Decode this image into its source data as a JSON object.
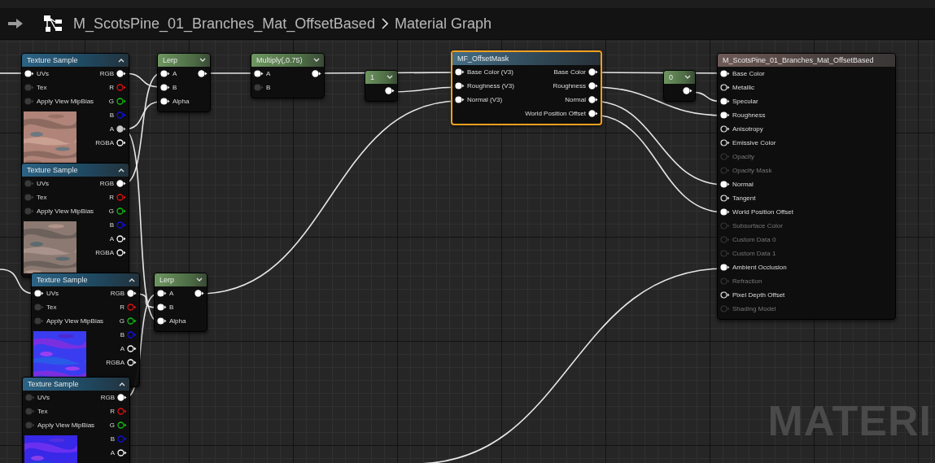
{
  "toolbar": {
    "title": "M_ScotsPine_01_Branches_Mat_OffsetBased",
    "breadcrumb": "Material Graph"
  },
  "nodes": [
    {
      "kind": "texture",
      "title": "Texture Sample",
      "selected": false,
      "inputs": [
        {
          "label": "UVs",
          "connected": true
        },
        {
          "label": "Tex",
          "connected": false
        },
        {
          "label": "Apply View MipBias",
          "connected": false
        }
      ],
      "outputs": [
        {
          "label": "RGB",
          "connected": true,
          "color": "#ffffff"
        },
        {
          "label": "R",
          "connected": false,
          "color": "#e01010"
        },
        {
          "label": "G",
          "connected": false,
          "color": "#10c010"
        },
        {
          "label": "B",
          "connected": false,
          "color": "#1010e0"
        },
        {
          "label": "A",
          "connected": true,
          "color": "#c8c8c8"
        },
        {
          "label": "RGBA",
          "connected": false,
          "color": "#ffffff"
        }
      ],
      "preview": {
        "kind": "picture"
      }
    },
    {
      "kind": "texture",
      "title": "Texture Sample",
      "selected": false,
      "inputs": [
        {
          "label": "UVs",
          "connected": false
        },
        {
          "label": "Tex",
          "connected": false
        },
        {
          "label": "Apply View MipBias",
          "connected": false
        }
      ],
      "outputs": [
        {
          "label": "RGB",
          "connected": true,
          "color": "#ffffff"
        },
        {
          "label": "R",
          "connected": false,
          "color": "#e01010"
        },
        {
          "label": "G",
          "connected": false,
          "color": "#10c010"
        },
        {
          "label": "B",
          "connected": false,
          "color": "#1010e0"
        },
        {
          "label": "A",
          "connected": false,
          "color": "#ffffff"
        },
        {
          "label": "RGBA",
          "connected": false,
          "color": "#ffffff"
        }
      ],
      "preview": {
        "kind": "picture"
      }
    },
    {
      "kind": "texture",
      "title": "Texture Sample",
      "selected": false,
      "inputs": [
        {
          "label": "UVs",
          "connected": true
        },
        {
          "label": "Tex",
          "connected": false
        },
        {
          "label": "Apply View MipBias",
          "connected": false
        }
      ],
      "outputs": [
        {
          "label": "RGB",
          "connected": true,
          "color": "#ffffff"
        },
        {
          "label": "R",
          "connected": false,
          "color": "#e01010"
        },
        {
          "label": "G",
          "connected": false,
          "color": "#10c010"
        },
        {
          "label": "B",
          "connected": false,
          "color": "#1010e0"
        },
        {
          "label": "A",
          "connected": false,
          "color": "#ffffff"
        },
        {
          "label": "RGBA",
          "connected": false,
          "color": "#ffffff"
        }
      ],
      "preview": {
        "kind": "picture"
      }
    },
    {
      "kind": "texture",
      "title": "Texture Sample",
      "selected": false,
      "inputs": [
        {
          "label": "UVs",
          "connected": false
        },
        {
          "label": "Tex",
          "connected": false
        },
        {
          "label": "Apply View MipBias",
          "connected": false
        }
      ],
      "outputs": [
        {
          "label": "RGB",
          "connected": true,
          "color": "#ffffff"
        },
        {
          "label": "R",
          "connected": false,
          "color": "#e01010"
        },
        {
          "label": "G",
          "connected": false,
          "color": "#10c010"
        },
        {
          "label": "B",
          "connected": false,
          "color": "#1010e0"
        },
        {
          "label": "A",
          "connected": false,
          "color": "#ffffff"
        }
      ],
      "preview": {
        "kind": "picture"
      }
    },
    {
      "kind": "math",
      "title": "Lerp",
      "selected": false,
      "inputs": [
        {
          "label": "A",
          "connected": true
        },
        {
          "label": "B",
          "connected": true
        },
        {
          "label": "Alpha",
          "connected": true
        }
      ],
      "outputs": [
        {
          "connected": true
        }
      ]
    },
    {
      "kind": "math",
      "title": "Lerp",
      "selected": false,
      "inputs": [
        {
          "label": "A",
          "connected": true
        },
        {
          "label": "B",
          "connected": true
        },
        {
          "label": "Alpha",
          "connected": true
        }
      ],
      "outputs": [
        {
          "connected": true
        }
      ]
    },
    {
      "kind": "math",
      "title": "Multiply(,0.75)",
      "selected": false,
      "inputs": [
        {
          "label": "A",
          "connected": true
        },
        {
          "label": "B",
          "connected": false
        }
      ],
      "outputs": [
        {
          "connected": true
        }
      ]
    },
    {
      "kind": "constant",
      "title": "1",
      "selected": false,
      "outputs": [
        {
          "connected": true
        }
      ]
    },
    {
      "kind": "function",
      "title": "MF_OffsetMask",
      "selected": true,
      "inputs": [
        {
          "label": "Base Color (V3)",
          "connected": true
        },
        {
          "label": "Roughness (V3)",
          "connected": true
        },
        {
          "label": "Normal (V3)",
          "connected": true
        }
      ],
      "outputs": [
        {
          "label": "Base Color",
          "connected": true
        },
        {
          "label": "Roughness",
          "connected": true
        },
        {
          "label": "Normal",
          "connected": true
        },
        {
          "label": "World Position Offset",
          "connected": true
        }
      ]
    },
    {
      "kind": "constant",
      "title": "0",
      "selected": false,
      "outputs": [
        {
          "connected": true
        }
      ]
    },
    {
      "kind": "result",
      "title": "M_ScotsPine_01_Branches_Mat_OffsetBased",
      "selected": false,
      "inputs": [
        {
          "label": "Base Color",
          "connected": true,
          "disabled": false
        },
        {
          "label": "Metallic",
          "connected": false,
          "disabled": false
        },
        {
          "label": "Specular",
          "connected": true,
          "disabled": false
        },
        {
          "label": "Roughness",
          "connected": true,
          "disabled": false
        },
        {
          "label": "Anisotropy",
          "connected": false,
          "disabled": false
        },
        {
          "label": "Emissive Color",
          "connected": false,
          "disabled": false
        },
        {
          "label": "Opacity",
          "connected": false,
          "disabled": true
        },
        {
          "label": "Opacity Mask",
          "connected": false,
          "disabled": true
        },
        {
          "label": "Normal",
          "connected": true,
          "disabled": false
        },
        {
          "label": "Tangent",
          "connected": false,
          "disabled": false
        },
        {
          "label": "World Position Offset",
          "connected": true,
          "disabled": false
        },
        {
          "label": "Subsurface Color",
          "connected": false,
          "disabled": true
        },
        {
          "label": "Custom Data 0",
          "connected": false,
          "disabled": true
        },
        {
          "label": "Custom Data 1",
          "connected": false,
          "disabled": true
        },
        {
          "label": "Ambient Occlusion",
          "connected": true,
          "disabled": false
        },
        {
          "label": "Refraction",
          "connected": false,
          "disabled": true
        },
        {
          "label": "Pixel Depth Offset",
          "connected": false,
          "disabled": false
        },
        {
          "label": "Shading Model",
          "connected": false,
          "disabled": true
        }
      ]
    }
  ],
  "watermark": "MATERI"
}
